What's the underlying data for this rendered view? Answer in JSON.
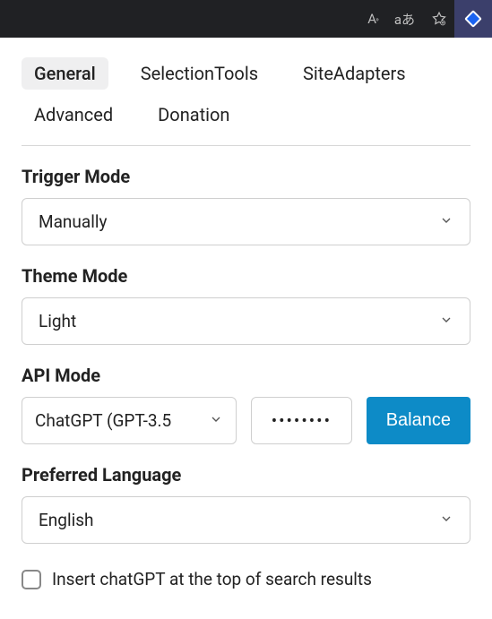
{
  "tabs": {
    "general": "General",
    "selection_tools": "SelectionTools",
    "site_adapters": "SiteAdapters",
    "advanced": "Advanced",
    "donation": "Donation"
  },
  "trigger_mode": {
    "label": "Trigger Mode",
    "value": "Manually"
  },
  "theme_mode": {
    "label": "Theme Mode",
    "value": "Light"
  },
  "api_mode": {
    "label": "API Mode",
    "select_value": "ChatGPT (GPT-3.5",
    "key_value": "••••••••",
    "balance_label": "Balance"
  },
  "preferred_language": {
    "label": "Preferred Language",
    "value": "English"
  },
  "insert_top": {
    "label": "Insert chatGPT at the top of search results",
    "checked": false
  },
  "topbar": {
    "read_aloud": "A",
    "translate": "aあ"
  }
}
